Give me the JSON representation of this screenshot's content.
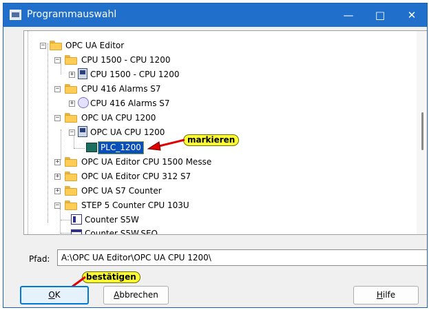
{
  "window": {
    "title": "Programmauswahl",
    "minimize": "—",
    "maximize": "□",
    "close": "✕"
  },
  "tree": [
    {
      "label": "OPC UA Editor",
      "icon": "folder-icon",
      "expander": "−"
    },
    {
      "label": "CPU 1500 - CPU 1200",
      "icon": "folder-icon",
      "expander": "−"
    },
    {
      "label": "CPU 1500 - CPU 1200",
      "icon": "program-icon",
      "expander": "+"
    },
    {
      "label": "CPU 416 Alarms S7",
      "icon": "folder-icon",
      "expander": "−"
    },
    {
      "label": "CPU 416 Alarms S7",
      "icon": "alarm-icon",
      "expander": "+"
    },
    {
      "label": "OPC UA CPU 1200",
      "icon": "folder-icon",
      "expander": "−"
    },
    {
      "label": "OPC UA CPU 1200",
      "icon": "program-icon",
      "expander": "−"
    },
    {
      "label": "PLC_1200",
      "icon": "plc-icon",
      "selected": true
    },
    {
      "label": "OPC UA Editor CPU 1500 Messe",
      "icon": "folder-icon",
      "expander": "+"
    },
    {
      "label": "OPC UA Editor CPU 312 S7",
      "icon": "folder-icon",
      "expander": "+"
    },
    {
      "label": "OPC UA S7 Counter",
      "icon": "folder-icon",
      "expander": "+"
    },
    {
      "label": "STEP 5 Counter CPU 103U",
      "icon": "folder-icon",
      "expander": "−"
    },
    {
      "label": "Counter S5W",
      "icon": "counter-icon"
    },
    {
      "label": "Counter S5W.SEQ",
      "icon": "sequence-icon"
    }
  ],
  "annotations": {
    "mark": "markieren",
    "confirm": "bestätigen"
  },
  "path": {
    "label": "Pfad:",
    "value": "A:\\OPC UA Editor\\OPC UA CPU 1200\\"
  },
  "buttons": {
    "ok": {
      "mnemonic": "O",
      "rest": "K"
    },
    "cancel": {
      "mnemonic": "A",
      "rest": "bbrechen"
    },
    "help": {
      "mnemonic": "H",
      "rest": "ilfe"
    }
  },
  "colors": {
    "titlebar": "#1f6fcb",
    "selection": "#0a4fb8",
    "callout": "#ffff33",
    "arrow": "#e00000",
    "ok_border": "#0078d7"
  }
}
